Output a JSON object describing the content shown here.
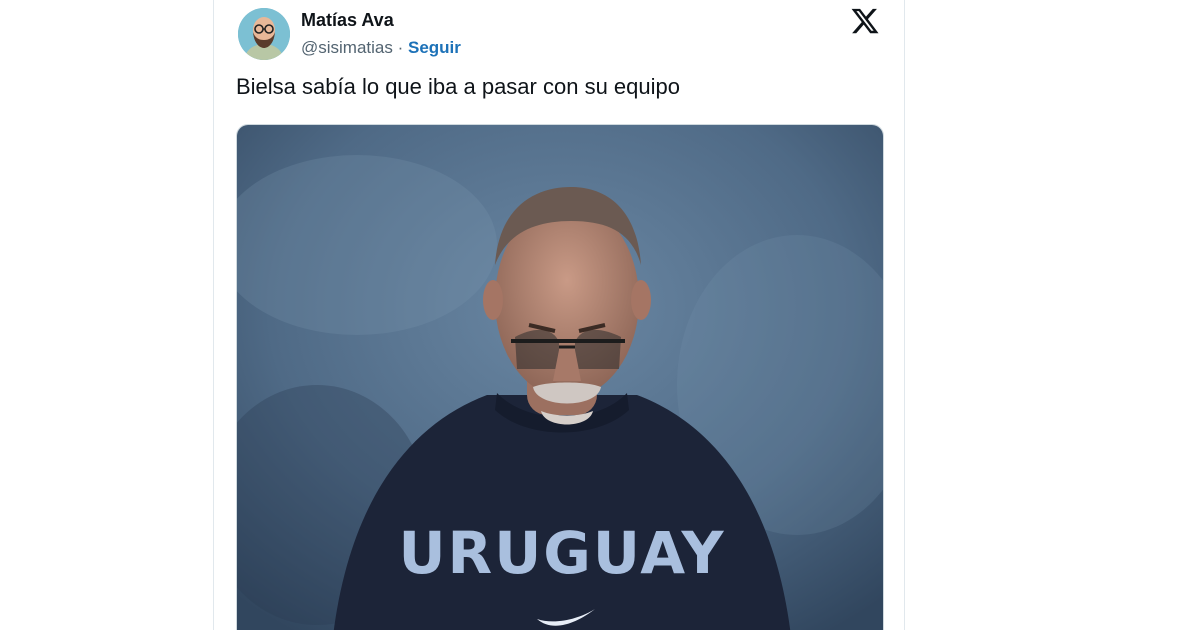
{
  "tweet": {
    "author": {
      "display_name": "Matías Ava",
      "handle": "@sisimatias",
      "separator": " · ",
      "follow_label": "Seguir",
      "avatar_icon": "bearded-man-glasses-avatar"
    },
    "platform_icon": "x-logo-icon",
    "text": "Bielsa sabía lo que iba a pasar con su equipo",
    "media": {
      "shirt_text": "URUGUAY",
      "colors": {
        "backdrop": "#4f6a86",
        "shirt": "#1c2438",
        "shirt_print": "#a9bfde",
        "accent_link": "#1d72b8"
      }
    }
  }
}
